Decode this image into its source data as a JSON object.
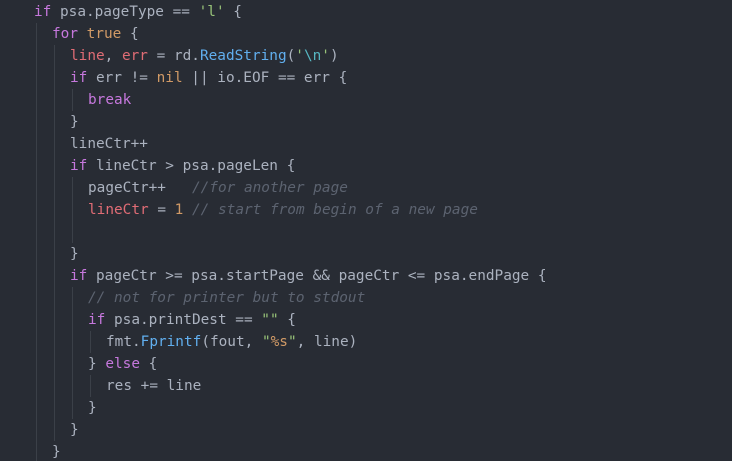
{
  "colors": {
    "background": "#282c34",
    "keyword": "#c678dd",
    "variable": "#e06c75",
    "plain": "#abb2bf",
    "function": "#61afef",
    "string": "#98c379",
    "number": "#d19a66",
    "comment": "#5c6370",
    "escape": "#56b6c2"
  },
  "code_lines": [
    {
      "indent": 1,
      "tokens": [
        {
          "t": "if",
          "c": "keyword"
        },
        {
          "t": " psa.pageType == ",
          "c": "plain"
        },
        {
          "t": "'l'",
          "c": "string"
        },
        {
          "t": " {",
          "c": "plain"
        }
      ]
    },
    {
      "indent": 2,
      "tokens": [
        {
          "t": "for",
          "c": "keyword"
        },
        {
          "t": " ",
          "c": "plain"
        },
        {
          "t": "true",
          "c": "number"
        },
        {
          "t": " {",
          "c": "plain"
        }
      ]
    },
    {
      "indent": 3,
      "tokens": [
        {
          "t": "line",
          "c": "variable"
        },
        {
          "t": ", ",
          "c": "plain"
        },
        {
          "t": "err",
          "c": "variable"
        },
        {
          "t": " = rd.",
          "c": "plain"
        },
        {
          "t": "ReadString",
          "c": "function"
        },
        {
          "t": "(",
          "c": "plain"
        },
        {
          "t": "'",
          "c": "string"
        },
        {
          "t": "\\n",
          "c": "escape"
        },
        {
          "t": "'",
          "c": "string"
        },
        {
          "t": ")",
          "c": "plain"
        }
      ]
    },
    {
      "indent": 3,
      "tokens": [
        {
          "t": "if",
          "c": "keyword"
        },
        {
          "t": " err != ",
          "c": "plain"
        },
        {
          "t": "nil",
          "c": "number"
        },
        {
          "t": " || io.EOF == err {",
          "c": "plain"
        }
      ]
    },
    {
      "indent": 4,
      "tokens": [
        {
          "t": "break",
          "c": "keyword"
        }
      ]
    },
    {
      "indent": 3,
      "tokens": [
        {
          "t": "}",
          "c": "plain"
        }
      ]
    },
    {
      "indent": 3,
      "tokens": [
        {
          "t": "lineCtr++",
          "c": "plain"
        }
      ]
    },
    {
      "indent": 3,
      "tokens": [
        {
          "t": "if",
          "c": "keyword"
        },
        {
          "t": " lineCtr > psa.pageLen {",
          "c": "plain"
        }
      ]
    },
    {
      "indent": 4,
      "tokens": [
        {
          "t": "pageCtr++   ",
          "c": "plain"
        },
        {
          "t": "//for another page",
          "c": "comment"
        }
      ]
    },
    {
      "indent": 4,
      "tokens": [
        {
          "t": "lineCtr",
          "c": "variable"
        },
        {
          "t": " = ",
          "c": "plain"
        },
        {
          "t": "1",
          "c": "number"
        },
        {
          "t": " ",
          "c": "plain"
        },
        {
          "t": "// start from begin of a new page",
          "c": "comment"
        }
      ]
    },
    {
      "indent": 4,
      "tokens": []
    },
    {
      "indent": 3,
      "tokens": [
        {
          "t": "}",
          "c": "plain"
        }
      ]
    },
    {
      "indent": 3,
      "tokens": [
        {
          "t": "if",
          "c": "keyword"
        },
        {
          "t": " pageCtr >= psa.startPage && pageCtr <= psa.endPage {",
          "c": "plain"
        }
      ]
    },
    {
      "indent": 4,
      "tokens": [
        {
          "t": "// not for printer but to stdout",
          "c": "comment"
        }
      ]
    },
    {
      "indent": 4,
      "tokens": [
        {
          "t": "if",
          "c": "keyword"
        },
        {
          "t": " psa.printDest == ",
          "c": "plain"
        },
        {
          "t": "\"\"",
          "c": "string"
        },
        {
          "t": " {",
          "c": "plain"
        }
      ]
    },
    {
      "indent": 5,
      "tokens": [
        {
          "t": "fmt.",
          "c": "plain"
        },
        {
          "t": "Fprintf",
          "c": "function"
        },
        {
          "t": "(fout, ",
          "c": "plain"
        },
        {
          "t": "\"",
          "c": "string"
        },
        {
          "t": "%s",
          "c": "number"
        },
        {
          "t": "\"",
          "c": "string"
        },
        {
          "t": ", line)",
          "c": "plain"
        }
      ]
    },
    {
      "indent": 4,
      "tokens": [
        {
          "t": "} ",
          "c": "plain"
        },
        {
          "t": "else",
          "c": "keyword"
        },
        {
          "t": " {",
          "c": "plain"
        }
      ]
    },
    {
      "indent": 5,
      "tokens": [
        {
          "t": "res += line",
          "c": "plain"
        }
      ]
    },
    {
      "indent": 4,
      "tokens": [
        {
          "t": "}",
          "c": "plain"
        }
      ]
    },
    {
      "indent": 3,
      "tokens": [
        {
          "t": "}",
          "c": "plain"
        }
      ]
    },
    {
      "indent": 2,
      "tokens": [
        {
          "t": "}",
          "c": "plain"
        }
      ]
    }
  ]
}
